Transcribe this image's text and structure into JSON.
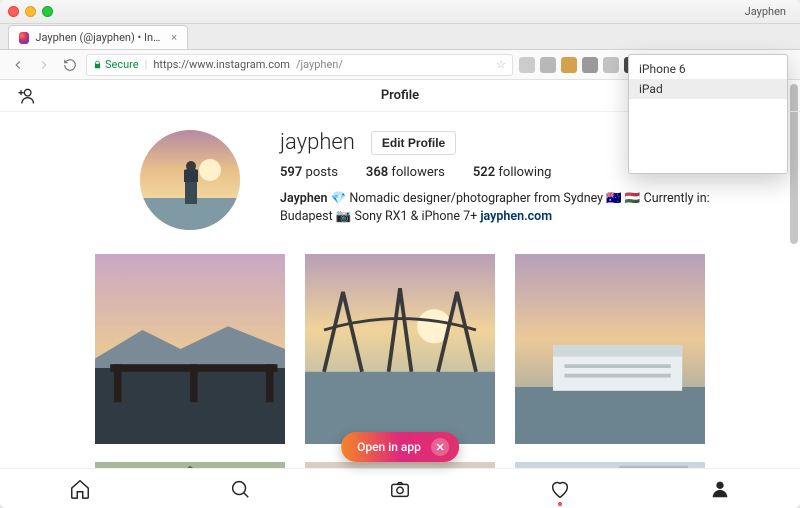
{
  "window": {
    "user_label": "Jayphen"
  },
  "tab": {
    "title": "Jayphen (@jayphen) • Instagr…"
  },
  "omnibox": {
    "secure_label": "Secure",
    "host": "https://www.instagram.com",
    "path": "/jayphen/"
  },
  "extension_popup": {
    "items": [
      {
        "label": "iPhone 6",
        "selected": false
      },
      {
        "label": "iPad",
        "selected": true
      }
    ]
  },
  "page": {
    "header_title": "Profile",
    "add_user_label": "Add friend"
  },
  "profile": {
    "username": "jayphen",
    "edit_button": "Edit Profile",
    "stats": {
      "posts_count": "597",
      "posts_label": "posts",
      "followers_count": "368",
      "followers_label": "followers",
      "following_count": "522",
      "following_label": "following"
    },
    "bio_name": "Jayphen",
    "bio_text_1": "Nomadic designer/photographer from Sydney",
    "bio_text_2": "Currently in: Budapest",
    "bio_text_3": "Sony RX1 & iPhone 7+",
    "bio_link": "jayphen.com"
  },
  "open_in_app": {
    "label": "Open in app"
  },
  "nav": {
    "home": "home",
    "search": "search",
    "camera": "camera",
    "activity": "activity",
    "profile": "profile"
  }
}
